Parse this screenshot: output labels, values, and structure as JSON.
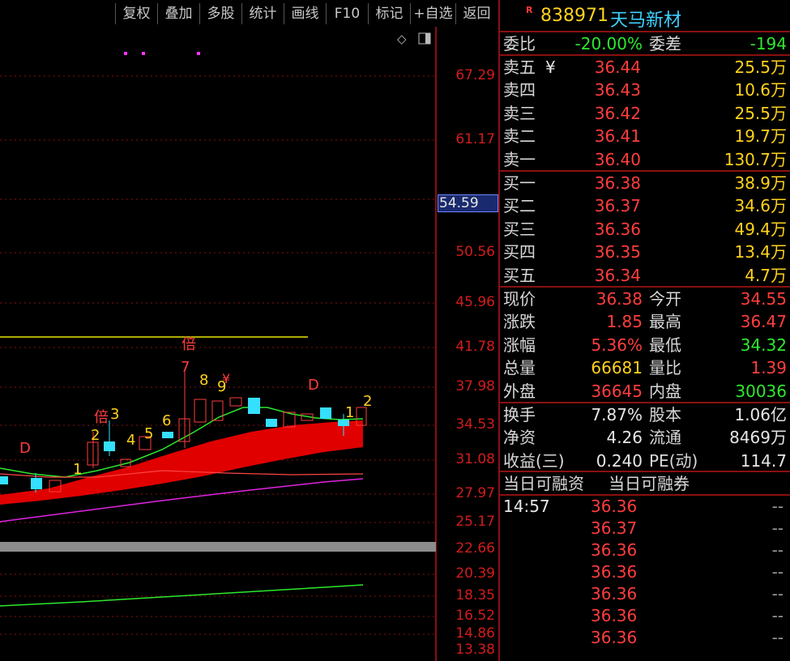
{
  "toolbar": {
    "buttons": [
      "复权",
      "叠加",
      "多股",
      "统计",
      "画线",
      "F10",
      "标记",
      "+自选",
      "返回"
    ]
  },
  "chart": {
    "price_ticks": [
      "67.29",
      "61.17",
      "54.59",
      "50.56",
      "45.96",
      "41.78",
      "37.98",
      "34.53",
      "31.08",
      "27.97",
      "25.17",
      "22.66",
      "20.39",
      "18.35",
      "16.52",
      "14.86",
      "13.38"
    ],
    "highlight_price": "54.59",
    "annotations": [
      "D",
      "1",
      "2",
      "倍",
      "3",
      "4",
      "5",
      "6",
      "7",
      "8",
      "¥",
      "9",
      "倍",
      "D",
      "1",
      "2"
    ]
  },
  "symbol": {
    "badge": "R",
    "code": "838971",
    "name": "天马新材"
  },
  "ratio": {
    "label": "委比",
    "value": "-20.00%",
    "diff_label": "委差",
    "diff_value": "-194"
  },
  "asks": [
    {
      "label": "卖五",
      "mark": "¥",
      "price": "36.44",
      "vol": "25.5万"
    },
    {
      "label": "卖四",
      "mark": "",
      "price": "36.43",
      "vol": "10.6万"
    },
    {
      "label": "卖三",
      "mark": "",
      "price": "36.42",
      "vol": "25.5万"
    },
    {
      "label": "卖二",
      "mark": "",
      "price": "36.41",
      "vol": "19.7万"
    },
    {
      "label": "卖一",
      "mark": "",
      "price": "36.40",
      "vol": "130.7万"
    }
  ],
  "bids": [
    {
      "label": "买一",
      "price": "36.38",
      "vol": "38.9万"
    },
    {
      "label": "买二",
      "price": "36.37",
      "vol": "34.6万"
    },
    {
      "label": "买三",
      "price": "36.36",
      "vol": "49.4万"
    },
    {
      "label": "买四",
      "price": "36.35",
      "vol": "13.4万"
    },
    {
      "label": "买五",
      "price": "36.34",
      "vol": "4.7万"
    }
  ],
  "stats1": [
    {
      "l1": "现价",
      "v1": "36.38",
      "c1": "red",
      "l2": "今开",
      "v2": "34.55",
      "c2": "red"
    },
    {
      "l1": "涨跌",
      "v1": "1.85",
      "c1": "red",
      "l2": "最高",
      "v2": "36.47",
      "c2": "red"
    },
    {
      "l1": "涨幅",
      "v1": "5.36%",
      "c1": "red",
      "l2": "最低",
      "v2": "34.32",
      "c2": "green"
    },
    {
      "l1": "总量",
      "v1": "66681",
      "c1": "yellow",
      "l2": "量比",
      "v2": "1.39",
      "c2": "red"
    },
    {
      "l1": "外盘",
      "v1": "36645",
      "c1": "red",
      "l2": "内盘",
      "v2": "30036",
      "c2": "green"
    }
  ],
  "stats2": [
    {
      "l1": "换手",
      "v1": "7.87%",
      "c1": "white",
      "l2": "股本",
      "v2": "1.06亿",
      "c2": "white"
    },
    {
      "l1": "净资",
      "v1": "4.26",
      "c1": "white",
      "l2": "流通",
      "v2": "8469万",
      "c2": "white"
    },
    {
      "l1": "收益(三)",
      "v1": "0.240",
      "c1": "white",
      "l2": "PE(动)",
      "v2": "114.7",
      "c2": "white"
    }
  ],
  "margin": {
    "l1": "当日可融资",
    "l2": "当日可融券"
  },
  "ticks": [
    {
      "time": "14:57",
      "price": "36.36",
      "vol": "--"
    },
    {
      "time": "",
      "price": "36.37",
      "vol": "--"
    },
    {
      "time": "",
      "price": "36.36",
      "vol": "--"
    },
    {
      "time": "",
      "price": "36.36",
      "vol": "--"
    },
    {
      "time": "",
      "price": "36.36",
      "vol": "--"
    },
    {
      "time": "",
      "price": "36.36",
      "vol": "--"
    },
    {
      "time": "",
      "price": "36.36",
      "vol": "--"
    }
  ],
  "colors": {
    "up": "#ff3d3d",
    "down": "#2ee82e",
    "accent": "#ffd21c",
    "border": "#8a1010"
  }
}
